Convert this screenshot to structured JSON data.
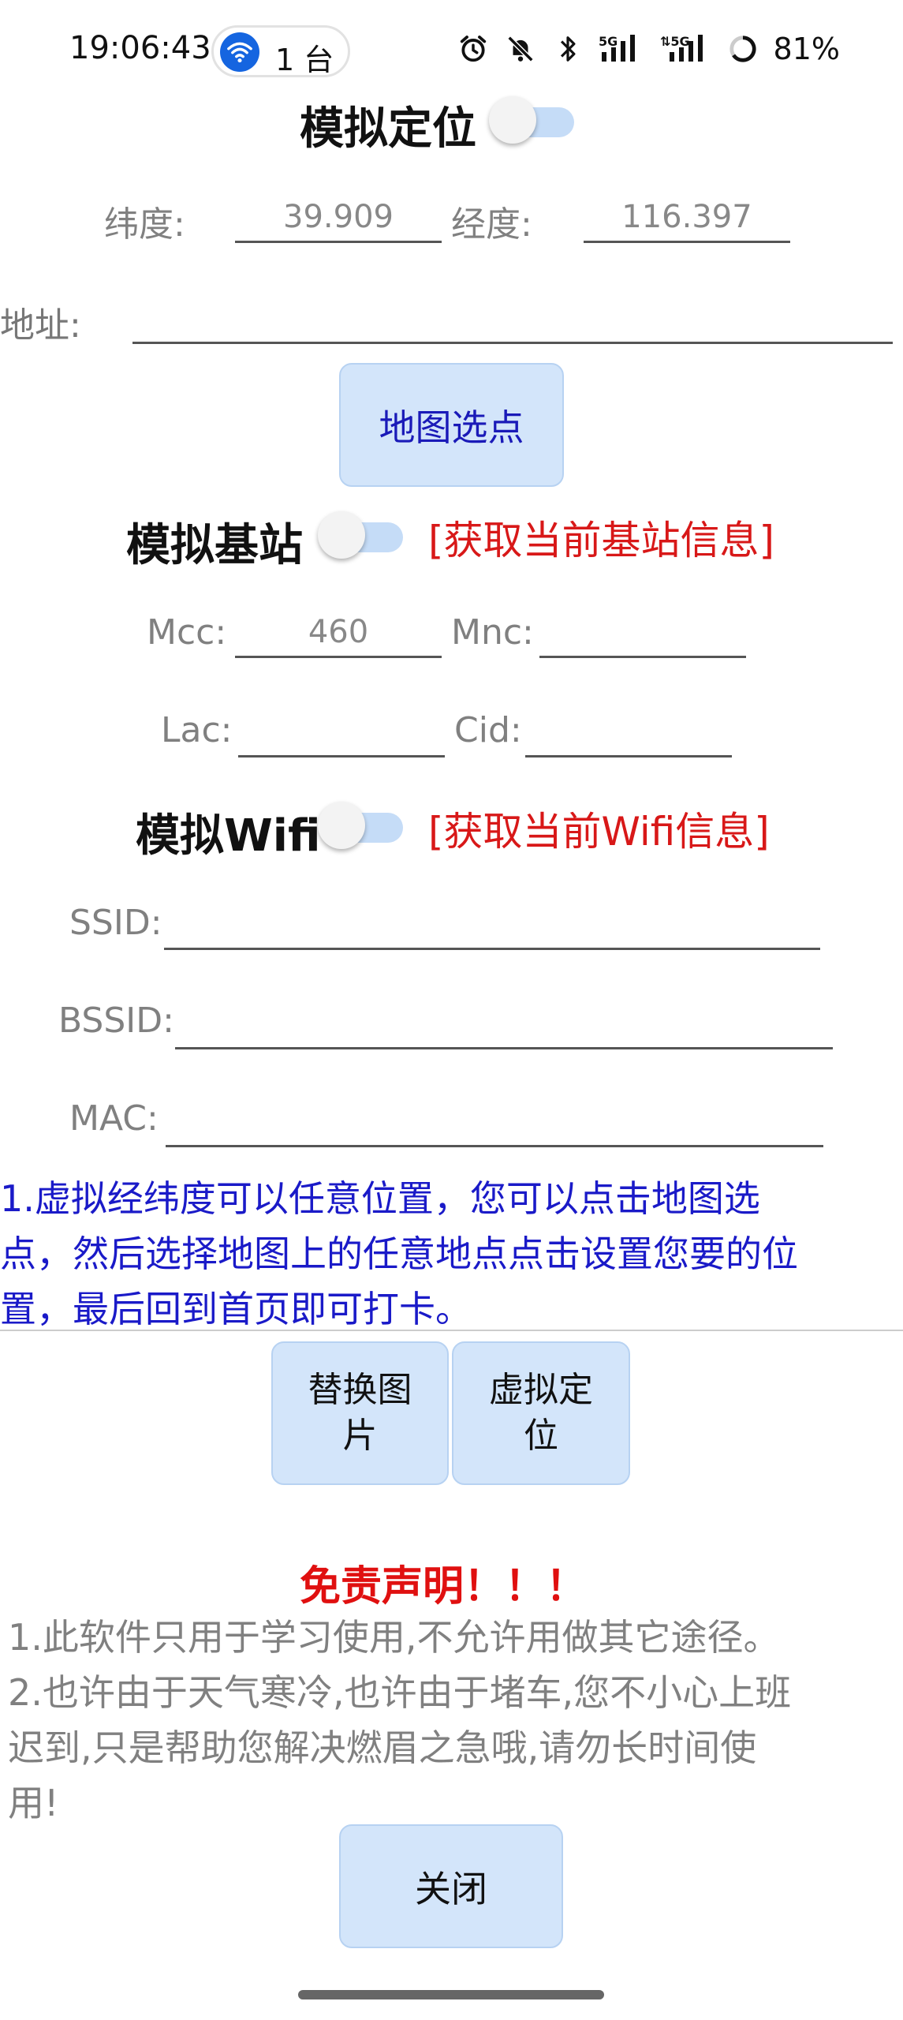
{
  "status_bar": {
    "time": "19:06:43",
    "hotspot_count": "1 台",
    "signal1": "5G",
    "signal2": "5G",
    "battery": "81%"
  },
  "mock_location": {
    "title": "模拟定位",
    "toggle_on": false,
    "lat_label": "纬度:",
    "lat_value": "39.909",
    "lng_label": "经度:",
    "lng_value": "116.397",
    "address_label": "地址:",
    "address_value": "",
    "map_button": "地图选点"
  },
  "mock_cell": {
    "title": "模拟基站",
    "toggle_on": false,
    "fetch_link": "[获取当前基站信息]",
    "mcc_label": "Mcc:",
    "mcc_value": "460",
    "mnc_label": "Mnc:",
    "mnc_value": "",
    "lac_label": "Lac:",
    "lac_value": "",
    "cid_label": "Cid:",
    "cid_value": ""
  },
  "mock_wifi": {
    "title": "模拟Wifi",
    "toggle_on": false,
    "fetch_link": "[获取当前Wifi信息]",
    "ssid_label": "SSID:",
    "ssid_value": "",
    "bssid_label": "BSSID:",
    "bssid_value": "",
    "mac_label": "MAC:",
    "mac_value": ""
  },
  "note": {
    "line1": "1.虚拟经纬度可以任意位置，您可以点击地图选",
    "line2": "点，然后选择地图上的任意地点点击设置您要的位",
    "line3": "置，最后回到首页即可打卡。"
  },
  "actions": {
    "replace_image_line1": "替换图",
    "replace_image_line2": "片",
    "virtual_location_line1": "虚拟定",
    "virtual_location_line2": "位"
  },
  "disclaimer": {
    "title": "免责声明！！！",
    "line1": "1.此软件只用于学习使用,不允许用做其它途径。",
    "line2": "2.也许由于天气寒冷,也许由于堵车,您不小心上班",
    "line3": "迟到,只是帮助您解决燃眉之急哦,请勿长时间使",
    "line4": "用!",
    "close_button": "关闭"
  },
  "colors": {
    "button_bg": "#d3e5fa",
    "link_red": "#d81818",
    "note_blue": "#1a1ac8",
    "disclaimer_title_red": "#e01010",
    "toggle_track": "#c5dcf7"
  }
}
